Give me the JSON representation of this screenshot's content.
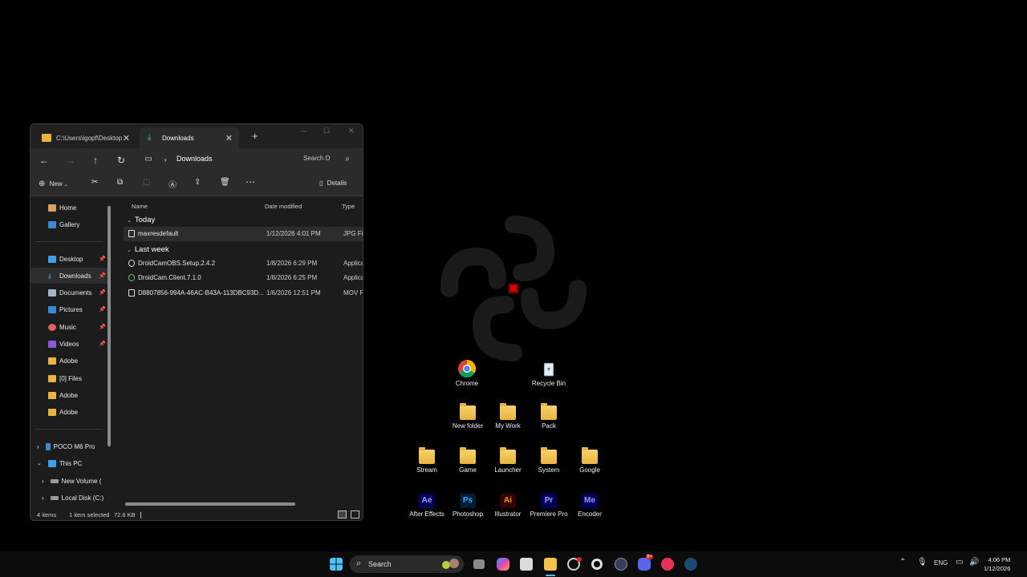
{
  "explorer": {
    "tabs": [
      {
        "label": "C:\\Users\\igopf\\Desktop"
      },
      {
        "label": "Downloads"
      }
    ],
    "breadcrumb": "Downloads",
    "search_placeholder": "Search D",
    "toolbar": {
      "new_label": "New",
      "details_label": "Details"
    },
    "sidebar": {
      "home": "Home",
      "gallery": "Gallery",
      "desktop": "Desktop",
      "downloads": "Downloads",
      "documents": "Documents",
      "pictures": "Pictures",
      "music": "Music",
      "videos": "Videos",
      "adobe1": "Adobe",
      "files": "[0] Files",
      "adobe2": "Adobe",
      "adobe3": "Adobe",
      "poco": "POCO M6 Pro",
      "thispc": "This PC",
      "newvolume": "New Volume (",
      "localdisk": "Local Disk (C:)"
    },
    "columns": {
      "name": "Name",
      "date": "Date modified",
      "type": "Type"
    },
    "groups": {
      "today": "Today",
      "lastweek": "Last week"
    },
    "files": [
      {
        "name": "maxresdefault",
        "date": "1/12/2026 4:01 PM",
        "type": "JPG File"
      },
      {
        "name": "DroidCamOBS.Setup.2.4.2",
        "date": "1/8/2026 6:29 PM",
        "type": "Applicati"
      },
      {
        "name": "DroidCam.Client.7.1.0",
        "date": "1/8/2026 6:25 PM",
        "type": "Applicati"
      },
      {
        "name": "D8807856-994A-46AC-B43A-113DBC93D...",
        "date": "1/6/2026 12:51 PM",
        "type": "MOV File"
      }
    ],
    "status": {
      "count": "4 items",
      "selected": "1 item selected",
      "size": "72.6 KB"
    }
  },
  "desktop_icons": {
    "chrome": "Chrome",
    "recycle": "Recycle Bin",
    "newfolder": "New folder",
    "mywork": "My Work",
    "pack": "Pack",
    "stream": "Stream",
    "game": "Game",
    "launcher": "Launcher",
    "system": "System",
    "google": "Google",
    "aftereffects": "After Effects",
    "photoshop": "Photoshop",
    "illustrator": "Illustrator",
    "premiere": "Premiere Pro",
    "encoder": "Encoder",
    "ae_glyph": "Ae",
    "ps_glyph": "Ps",
    "ai_glyph": "Ai",
    "pr_glyph": "Pr",
    "me_glyph": "Me"
  },
  "taskbar": {
    "search_label": "Search",
    "lang": "ENG",
    "time": "4:06 PM",
    "date": "1/12/2026",
    "discord_badge": "9+"
  }
}
